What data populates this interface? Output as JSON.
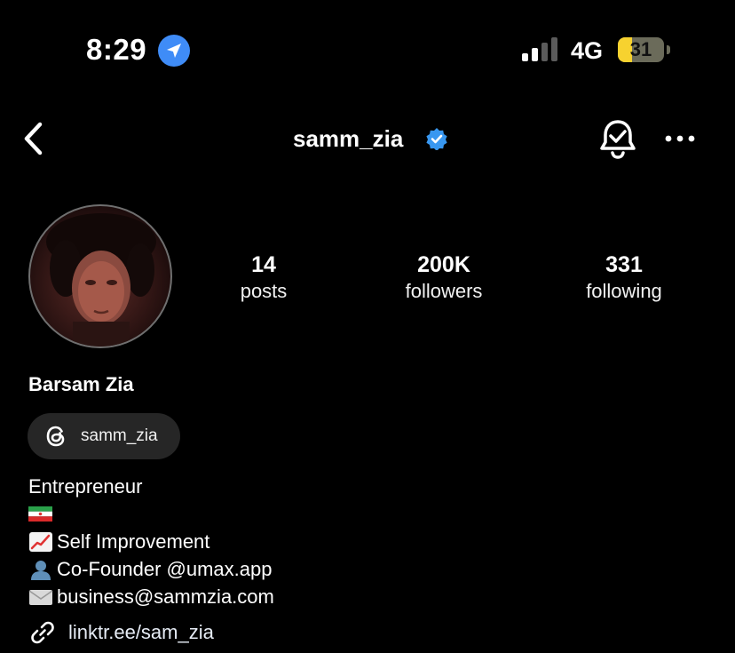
{
  "status_bar": {
    "time": "8:29",
    "network": "4G",
    "battery": "31",
    "battery_level": 0.31,
    "location_icon": "location-arrow-icon",
    "signal_icon": "signal-bars-icon"
  },
  "header": {
    "username": "samm_zia",
    "back_icon": "chevron-left-icon",
    "verified_icon": "verified-badge-icon",
    "notify_icon": "bell-check-icon",
    "more_icon": "more-horizontal-icon"
  },
  "profile": {
    "stats": [
      {
        "value": "14",
        "label": "posts"
      },
      {
        "value": "200K",
        "label": "followers"
      },
      {
        "value": "331",
        "label": "following"
      }
    ],
    "name": "Barsam Zia",
    "threads_handle": "samm_zia",
    "bio": {
      "line1": "Entrepreneur",
      "line3": "Self Improvement",
      "line4": "Co-Founder @umax.app",
      "line5": "business@sammzia.com"
    },
    "link": "linktr.ee/sam_zia"
  },
  "colors": {
    "background": "#000000",
    "verified": "#3897f0",
    "location": "#3f8cf7",
    "battery": "#f7d22f",
    "chip": "#262626"
  }
}
